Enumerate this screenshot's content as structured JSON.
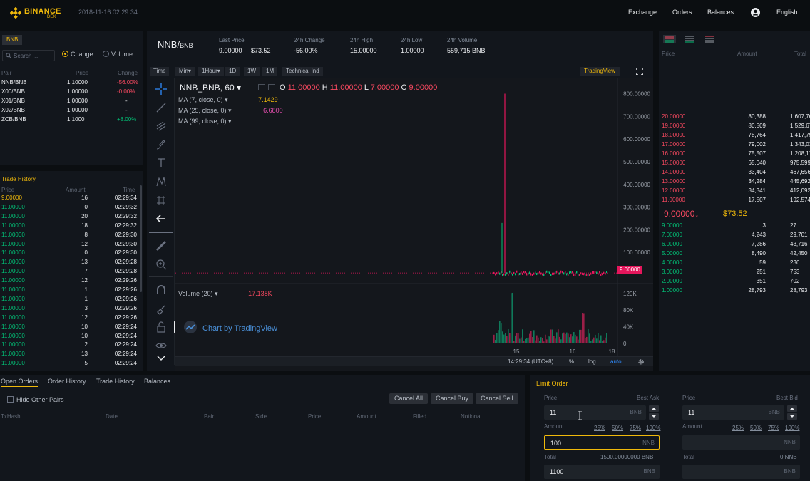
{
  "header": {
    "brand": "BINANCE",
    "brand_sub": "DEX",
    "datetime": "2018-11-16 02:29:34",
    "nav": [
      "Exchange",
      "Orders",
      "Balances"
    ],
    "language": "English"
  },
  "markets": {
    "tab": "BNB",
    "search_placeholder": "Search ...",
    "toggle": [
      "Change",
      "Volume"
    ],
    "cols": [
      "Pair",
      "Price",
      "Change"
    ],
    "rows": [
      [
        "NNB/BNB",
        "1.10000",
        "-56.00%"
      ],
      [
        "X00/BNB",
        "1.00000",
        "-0.00%"
      ],
      [
        "X01/BNB",
        "1.00000",
        "-"
      ],
      [
        "X02/BNB",
        "1.00000",
        "-"
      ],
      [
        "ZCB/BNB",
        "1.1000",
        "+8.00%"
      ]
    ]
  },
  "trade_history": {
    "title": "Trade History",
    "cols": [
      "Price",
      "Amount",
      "Time"
    ],
    "rows": [
      [
        "9.00000",
        "16",
        "02:29:34"
      ],
      [
        "11.00000",
        "0",
        "02:29:32"
      ],
      [
        "11.00000",
        "20",
        "02:29:32"
      ],
      [
        "11.00000",
        "18",
        "02:29:32"
      ],
      [
        "11.00000",
        "8",
        "02:29:30"
      ],
      [
        "11.00000",
        "12",
        "02:29:30"
      ],
      [
        "11.00000",
        "0",
        "02:29:30"
      ],
      [
        "11.00000",
        "13",
        "02:29:28"
      ],
      [
        "11.00000",
        "7",
        "02:29:28"
      ],
      [
        "11.00000",
        "12",
        "02:29:26"
      ],
      [
        "11.00000",
        "1",
        "02:29:26"
      ],
      [
        "11.00000",
        "1",
        "02:29:26"
      ],
      [
        "11.00000",
        "3",
        "02:29:26"
      ],
      [
        "11.00000",
        "12",
        "02:29:26"
      ],
      [
        "11.00000",
        "10",
        "02:29:24"
      ],
      [
        "11.00000",
        "10",
        "02:29:24"
      ],
      [
        "11.00000",
        "2",
        "02:29:24"
      ],
      [
        "11.00000",
        "13",
        "02:29:24"
      ],
      [
        "11.00000",
        "5",
        "02:29:24"
      ]
    ]
  },
  "ticker": {
    "pair": "NNB/",
    "pair_quote": "BNB",
    "last_price_label": "Last Price",
    "last_price": "9.00000",
    "last_price_usd": "$73.52",
    "change_label": "24h Change",
    "change": "-56.00%",
    "high_label": "24h High",
    "high": "15.00000",
    "low_label": "24h Low",
    "low": "1.00000",
    "volume_label": "24h Volume",
    "volume": "559,715 BNB"
  },
  "chart_toolbar": {
    "buttons": [
      "Time",
      "Min▾",
      "1Hour▾",
      "1D",
      "1W",
      "1M",
      "Technical Ind"
    ],
    "active": "1Hour▾",
    "tradingview": "TradingView"
  },
  "chart_info": {
    "symbol": "NNB_BNB, 60",
    "o_label": "O",
    "o": "11.00000",
    "h_label": "H",
    "h": "11.00000",
    "l_label": "L",
    "l": "7.00000",
    "c_label": "C",
    "c": "9.00000",
    "ma": [
      {
        "label": "MA (7, close, 0)",
        "value": "7.1429",
        "color": "#f0b90b"
      },
      {
        "label": "MA (25, close, 0)",
        "value": "6.6800",
        "color": "#e64fb0"
      },
      {
        "label": "MA (99, close, 0)",
        "value": ""
      }
    ],
    "volume_label": "Volume (20)",
    "volume_value": "17.138K",
    "watermark": "Chart by TradingView",
    "current_price_tag": "9.00000",
    "time_readout": "14:29:34 (UTC+8)",
    "bottom_opts": [
      "%",
      "log",
      "auto"
    ]
  },
  "chart_data": {
    "type": "candlestick",
    "x_ticks": [
      "15",
      "16",
      "18"
    ],
    "y_ticks": [
      "800.00000",
      "700.00000",
      "600.00000",
      "500.00000",
      "400.00000",
      "300.00000",
      "200.00000",
      "100.00000"
    ],
    "ylim": [
      0,
      830
    ],
    "vol_ticks": [
      "120K",
      "80K",
      "40K",
      "0"
    ],
    "vol_ylim": [
      0,
      130000
    ],
    "last_close": 9,
    "spike_high": 800
  },
  "orderbook": {
    "cols": [
      "Price",
      "Amount",
      "Total"
    ],
    "asks": [
      [
        "20.00000",
        "80,388",
        "1,607,760"
      ],
      [
        "19.00000",
        "80,509",
        "1,529,671"
      ],
      [
        "18.00000",
        "78,764",
        "1,417,752"
      ],
      [
        "17.00000",
        "79,002",
        "1,343,034"
      ],
      [
        "16.00000",
        "75,507",
        "1,208,112"
      ],
      [
        "15.00000",
        "65,040",
        "975,599"
      ],
      [
        "14.00000",
        "33,404",
        "467,656"
      ],
      [
        "13.00000",
        "34,284",
        "445,692"
      ],
      [
        "12.00000",
        "34,341",
        "412,092"
      ],
      [
        "11.00000",
        "17,507",
        "192,574"
      ]
    ],
    "mid_price": "9.00000",
    "mid_usd": "$73.52",
    "bids": [
      [
        "9.00000",
        "3",
        "27"
      ],
      [
        "7.00000",
        "4,243",
        "29,701"
      ],
      [
        "6.00000",
        "7,286",
        "43,716"
      ],
      [
        "5.00000",
        "8,490",
        "42,450"
      ],
      [
        "4.00000",
        "59",
        "236"
      ],
      [
        "3.00000",
        "251",
        "753"
      ],
      [
        "2.00000",
        "351",
        "702"
      ],
      [
        "1.00000",
        "28,793",
        "28,793"
      ]
    ]
  },
  "open_orders": {
    "tabs": [
      "Open Orders",
      "Order History",
      "Trade History",
      "Balances"
    ],
    "hide_label": "Hide Other Pairs",
    "buttons": [
      "Cancel All",
      "Cancel Buy",
      "Cancel Sell"
    ],
    "cols": [
      "TxHash",
      "Date",
      "Pair",
      "Side",
      "Price",
      "Amount",
      "Filled",
      "Notional"
    ]
  },
  "limit_order": {
    "title": "Limit Order",
    "buy": {
      "price_label": "Price",
      "best": "Best Ask",
      "price": "11",
      "unit": "BNB",
      "amount_label": "Amount",
      "amount": "100",
      "amount_unit": "NNB",
      "total_label": "Total",
      "total": "1500.00000000 BNB",
      "total_field": "1100",
      "total_unit": "BNB"
    },
    "sell": {
      "price_label": "Price",
      "best": "Best Bid",
      "price": "11",
      "unit": "BNB",
      "amount_label": "Amount",
      "amount": "",
      "amount_unit": "NNB",
      "total_label": "Total",
      "total": "0 NNB",
      "total_unit": "BNB"
    },
    "pcts": [
      "25%",
      "50%",
      "75%",
      "100%"
    ]
  }
}
